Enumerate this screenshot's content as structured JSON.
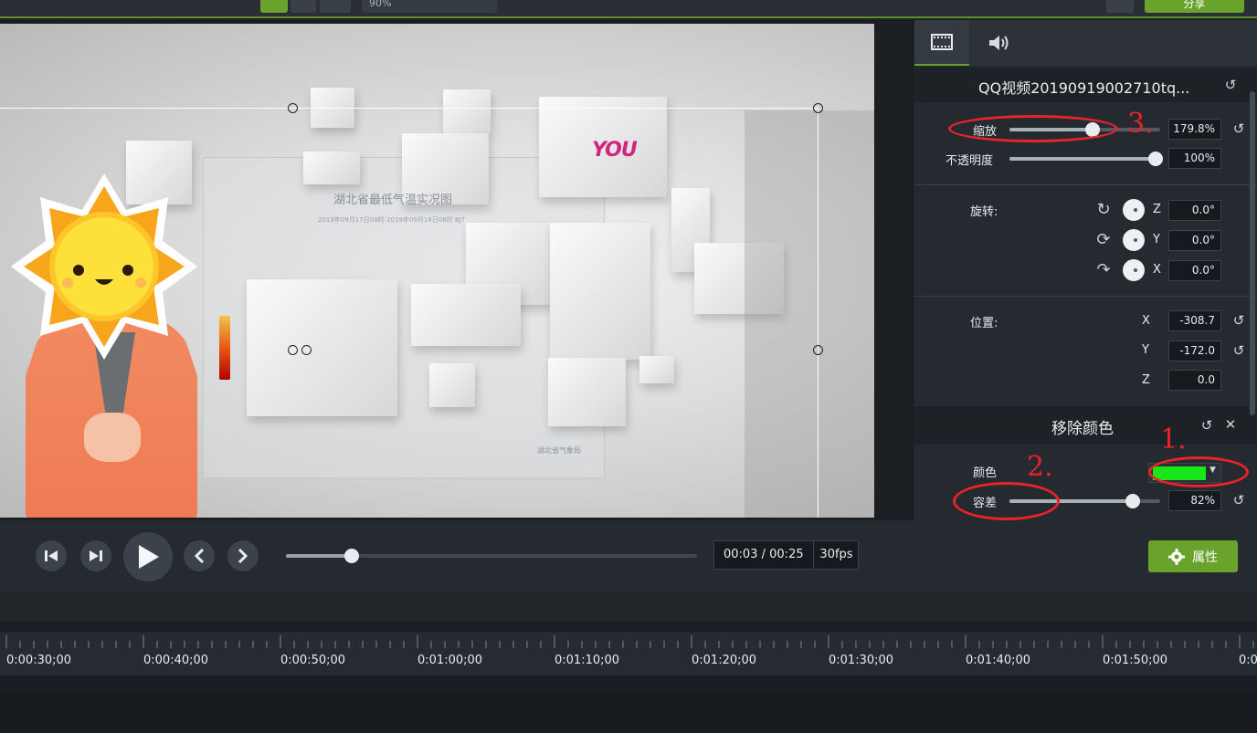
{
  "toolbar": {
    "zoom_value": "90%",
    "share_label": "分享"
  },
  "video": {
    "board_title": "湖北省最低气温实况图",
    "board_subtitle": "2019年09月17日08时-2019年09月18日08时 BJT",
    "board_credit": "湖北省气象局",
    "logo_text": "YOU"
  },
  "props": {
    "clip_title": "QQ视频20190919002710tq...",
    "scale": {
      "label": "缩放",
      "value": "179.8%",
      "level": 0.55
    },
    "opacity": {
      "label": "不透明度",
      "value": "100%",
      "level": 1.0
    },
    "rotation": {
      "label": "旋转:",
      "z": {
        "axis": "Z",
        "value": "0.0°"
      },
      "y": {
        "axis": "Y",
        "value": "0.0°"
      },
      "x": {
        "axis": "X",
        "value": "0.0°"
      }
    },
    "position": {
      "label": "位置:",
      "x": {
        "axis": "X",
        "value": "-308.7"
      },
      "y": {
        "axis": "Y",
        "value": "-172.0"
      },
      "z": {
        "axis": "Z",
        "value": "0.0"
      }
    },
    "remove_color": {
      "title": "移除颜色",
      "color_label": "颜色",
      "color_value": "#19e619",
      "tolerance_label": "容差",
      "tolerance_value": "82%",
      "tolerance_level": 0.82
    }
  },
  "annotations": {
    "one": "1.",
    "two": "2.",
    "three": "3."
  },
  "transport": {
    "time_current": "00:03",
    "time_separator": "/",
    "time_total": "00:25",
    "fps": "30fps",
    "progress": 0.16,
    "properties_label": "属性"
  },
  "timeline": {
    "ticks": [
      "0:00:30;00",
      "0:00:40;00",
      "0:00:50;00",
      "0:01:00;00",
      "0:01:10;00",
      "0:01:20;00",
      "0:01:30;00",
      "0:01:40;00",
      "0:01:50;00",
      "0:0"
    ]
  },
  "colors": {
    "accent": "#6aa32b",
    "annotation": "#e8232b"
  }
}
